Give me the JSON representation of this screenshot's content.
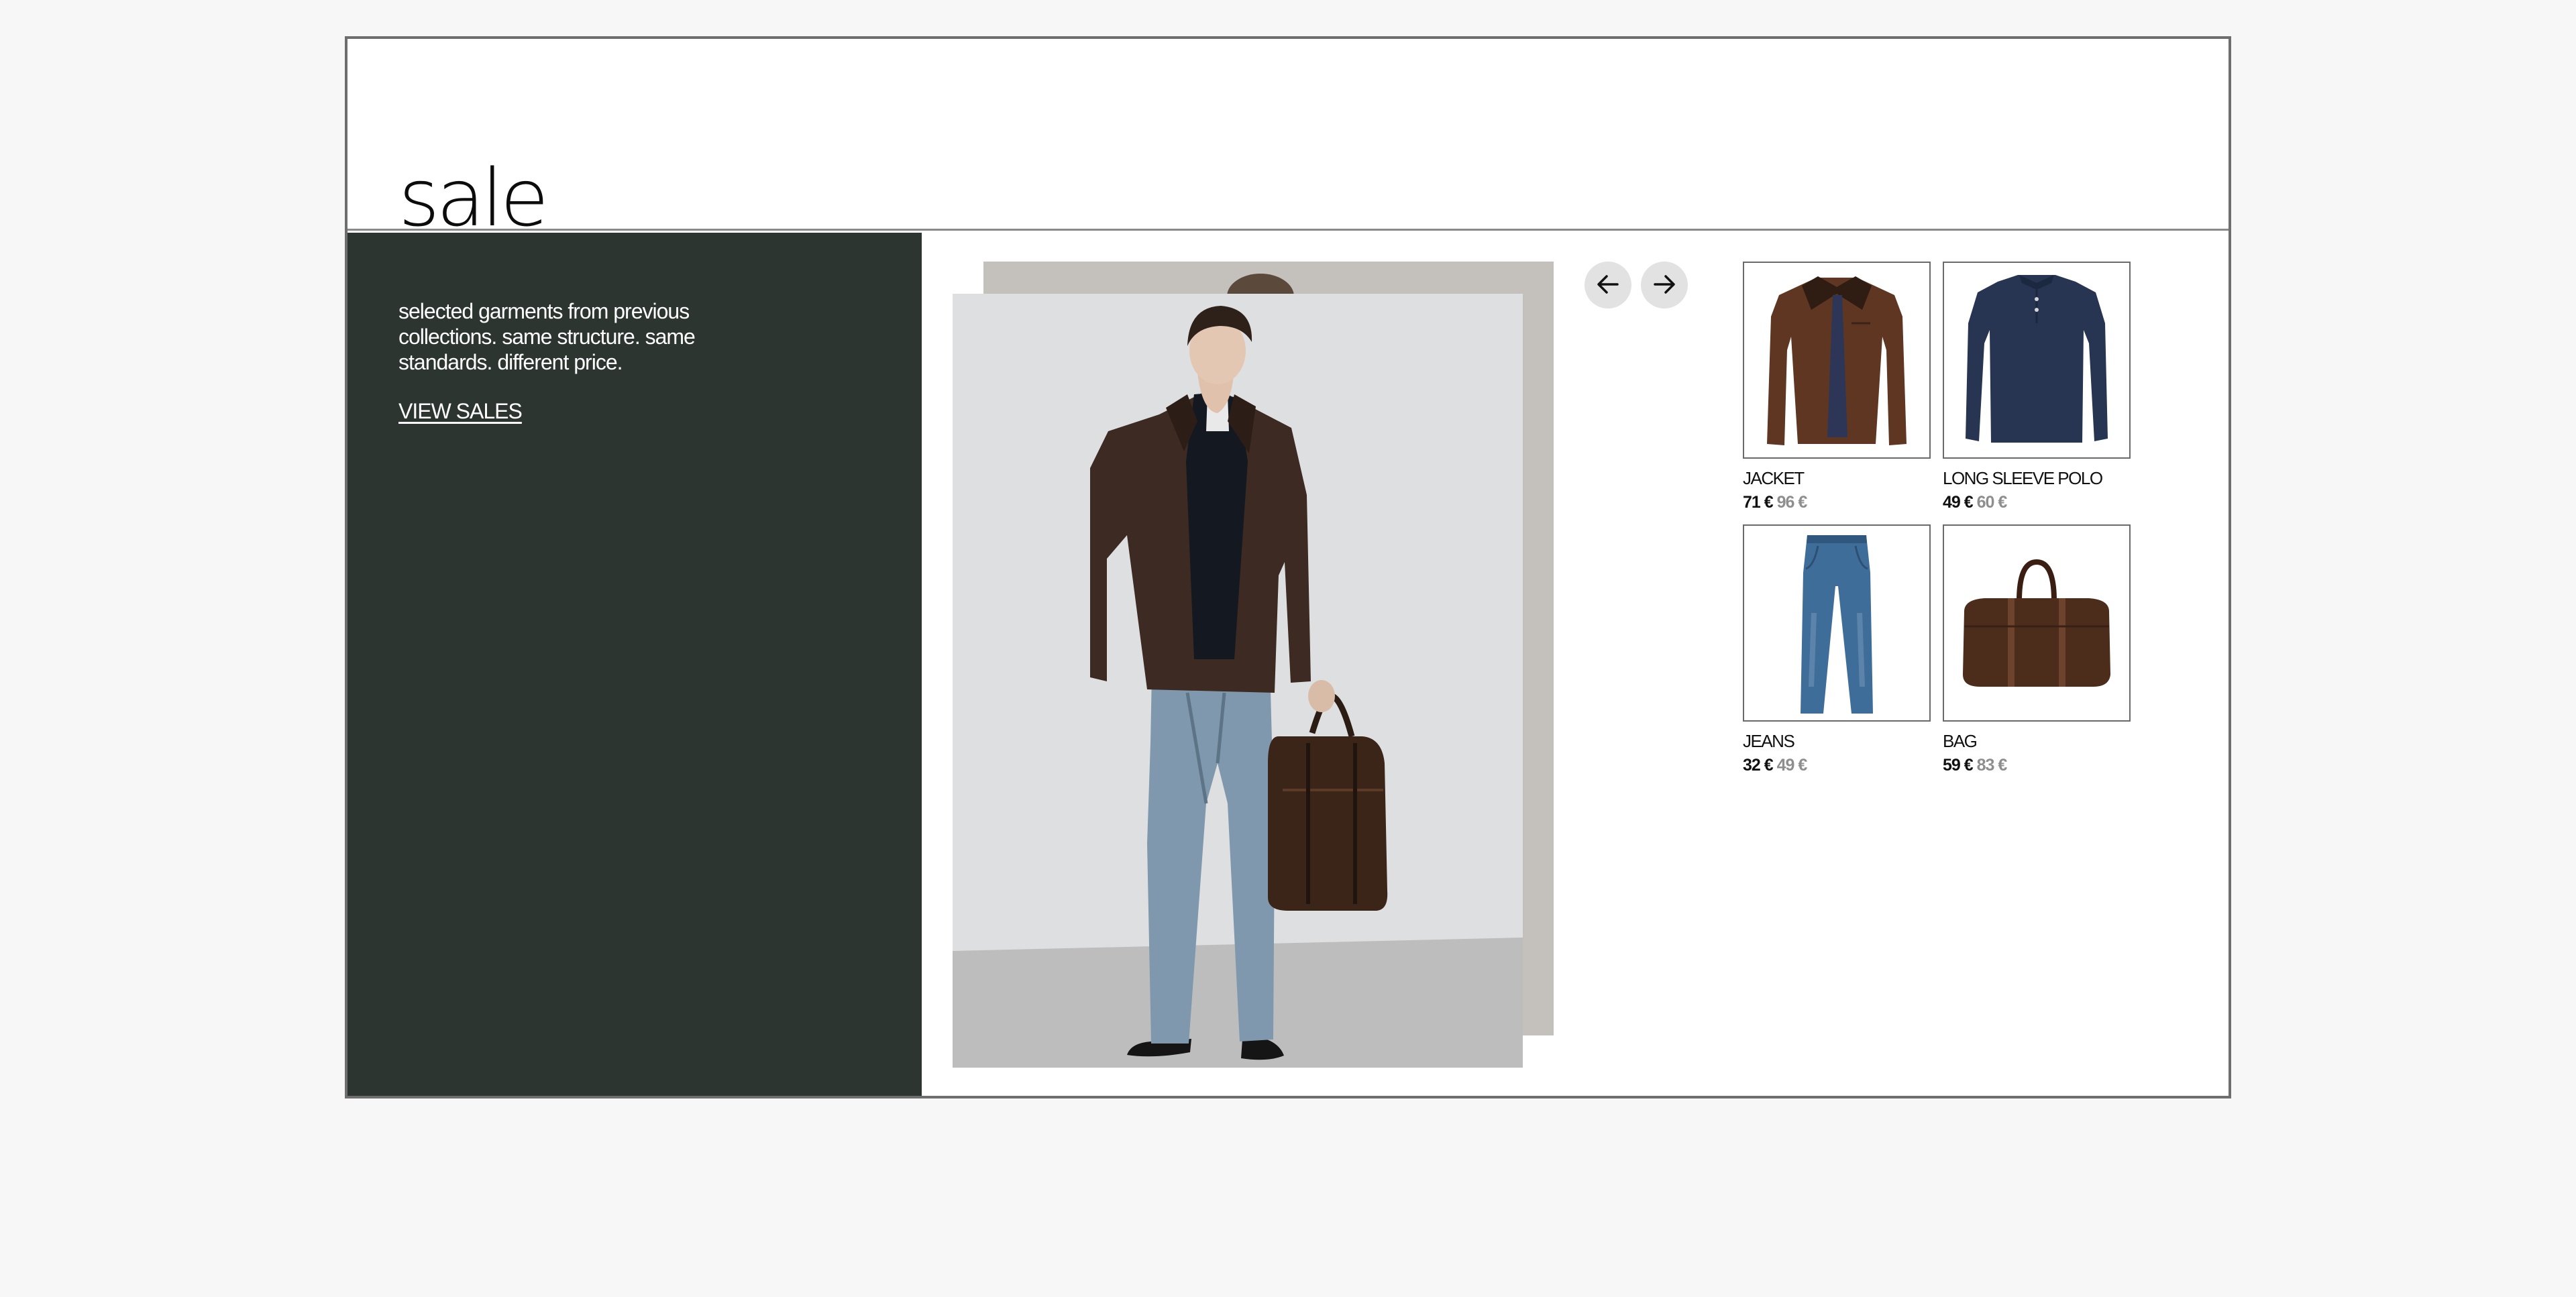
{
  "page": {
    "title": "sale"
  },
  "promo": {
    "lines": [
      "selected garments from previous",
      "collections. same structure. same",
      "standards. different price."
    ],
    "link_label": "VIEW SALES"
  },
  "carousel": {
    "prev_icon": "arrow-left-icon",
    "next_icon": "arrow-right-icon"
  },
  "products": [
    {
      "name": "JACKET",
      "price": "71 €",
      "old_price": "96 €",
      "image": "brown-jacket"
    },
    {
      "name": "LONG SLEEVE POLO",
      "price": "49 €",
      "old_price": "60 €",
      "image": "navy-polo"
    },
    {
      "name": "JEANS",
      "price": "32 €",
      "old_price": "49 €",
      "image": "blue-jeans"
    },
    {
      "name": "BAG",
      "price": "59 €",
      "old_price": "83 €",
      "image": "brown-duffel-bag"
    }
  ],
  "colors": {
    "panel": "#2d3531",
    "background": "#f7f7f7",
    "old_price": "#8e8e8e"
  }
}
